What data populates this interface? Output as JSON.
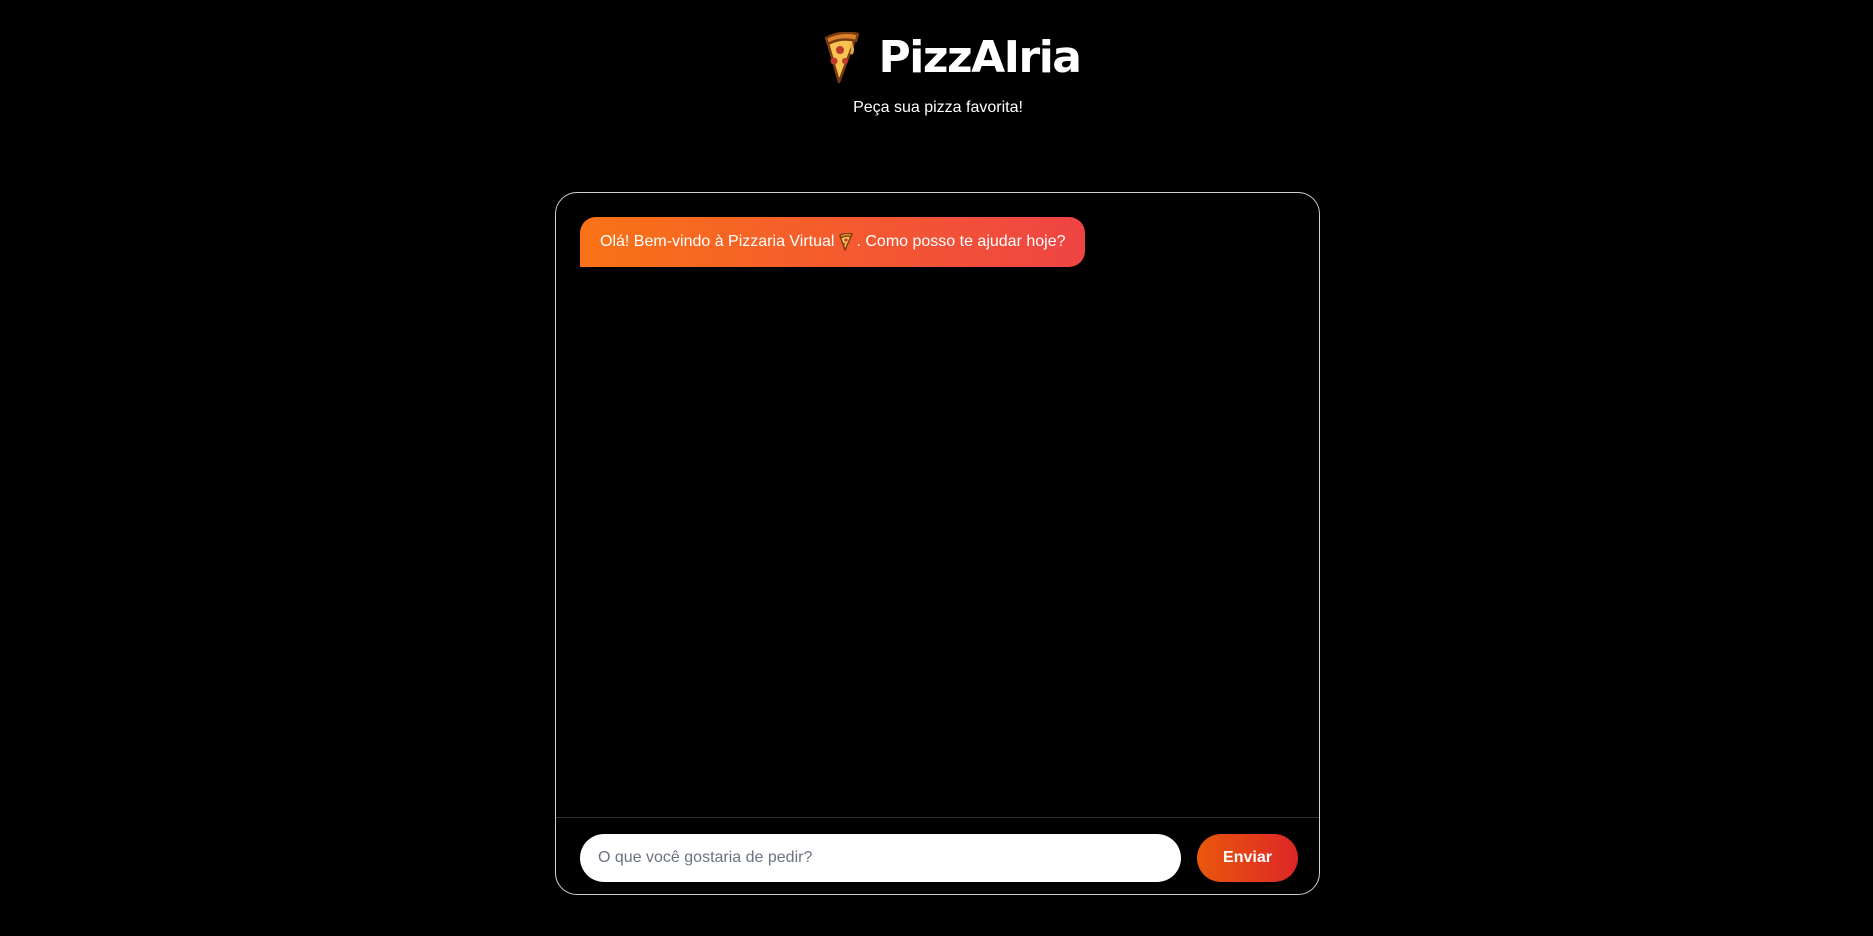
{
  "header": {
    "icon": "pizza-slice-icon",
    "title": "PizzAIria",
    "subtitle": "Peça sua pizza favorita!"
  },
  "chat": {
    "messages": [
      {
        "sender": "bot",
        "text_before": "Olá! Bem-vindo à Pizzaria Virtual ",
        "icon": "pizza-slice-icon",
        "text_after": ". Como posso te ajudar hoje?"
      }
    ]
  },
  "composer": {
    "placeholder": "O que você gostaria de pedir?",
    "value": "",
    "send_label": "Enviar"
  },
  "colors": {
    "background": "#000000",
    "accent_start": "#f97316",
    "accent_end": "#ef4444",
    "card_border": "#cfcfcf"
  }
}
